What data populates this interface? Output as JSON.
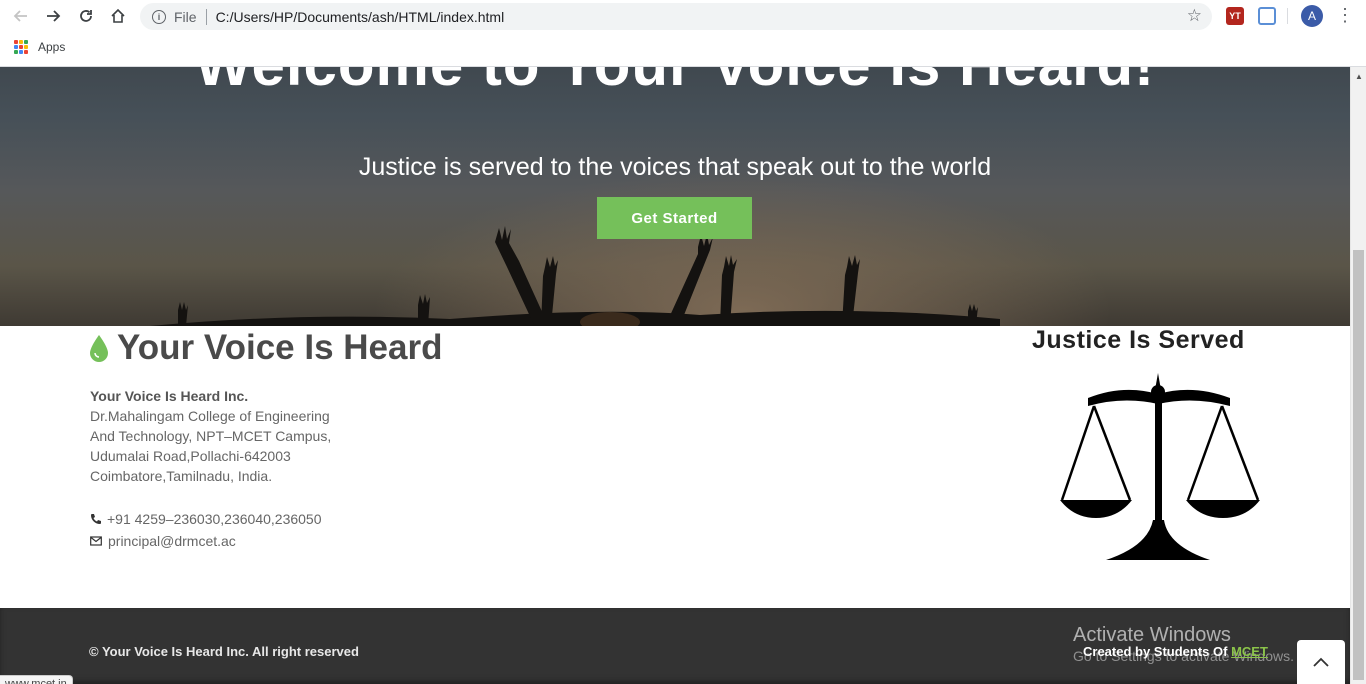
{
  "browser": {
    "scheme_label": "File",
    "url": "C:/Users/HP/Documents/ash/HTML/index.html",
    "apps_label": "Apps",
    "avatar_letter": "A",
    "status_url": "www.mcet.in"
  },
  "hero": {
    "title": "Welcome to Your Voice Is Heard!",
    "subtitle": "Justice is served to the voices that speak out to the world",
    "cta_label": "Get Started",
    "cta_color": "#75c05a"
  },
  "brand": {
    "name": "Your Voice Is Heard",
    "icon": "water-drop-icon",
    "accent": "#75c05a"
  },
  "address": {
    "org": "Your Voice Is Heard Inc.",
    "lines": [
      "Dr.Mahalingam College of Engineering",
      "And Technology, NPT–MCET Campus,",
      "Udumalai Road,Pollachi-642003",
      "Coimbatore,Tamilnadu, India."
    ]
  },
  "contact": {
    "phone": "+91 4259–236030,236040,236050",
    "email": "principal@drmcet.ac"
  },
  "justice": {
    "title": "Justice Is Served",
    "icon": "scales-of-justice-icon"
  },
  "footer": {
    "copyright": "© Your Voice Is Heard Inc. All right reserved",
    "credit_prefix": "Created by Students Of ",
    "credit_link": "MCET"
  },
  "os_overlay": {
    "title": "Activate Windows",
    "subtitle": "Go to Settings to activate Windows."
  }
}
